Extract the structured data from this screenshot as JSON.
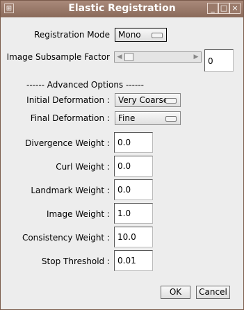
{
  "window": {
    "title": "Elastic Registration",
    "minimize_icon": "minimize-icon",
    "maximize_icon": "maximize-icon",
    "close_icon": "close-icon"
  },
  "registration_mode": {
    "label": "Registration Mode",
    "value": "Mono"
  },
  "subsample": {
    "label": "Image Subsample Factor",
    "value": "0",
    "slider_value": 0
  },
  "advanced": {
    "header": "------ Advanced Options ------"
  },
  "initial_deformation": {
    "label": "Initial Deformation :",
    "value": "Very Coarse"
  },
  "final_deformation": {
    "label": "Final Deformation :",
    "value": "Fine"
  },
  "weights": [
    {
      "label": "Divergence Weight :",
      "value": "0.0"
    },
    {
      "label": "Curl Weight :",
      "value": "0.0"
    },
    {
      "label": "Landmark Weight :",
      "value": "0.0"
    },
    {
      "label": "Image Weight :",
      "value": "1.0"
    },
    {
      "label": "Consistency Weight :",
      "value": "10.0"
    },
    {
      "label": "Stop Threshold :",
      "value": "0.01"
    }
  ],
  "buttons": {
    "ok": "OK",
    "cancel": "Cancel"
  }
}
